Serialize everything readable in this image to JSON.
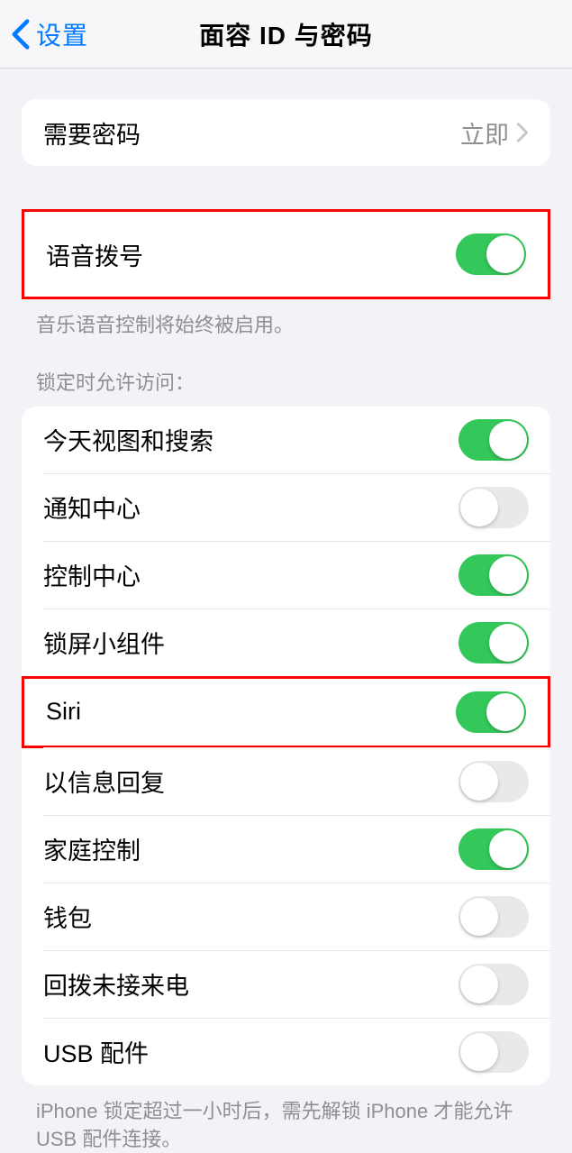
{
  "nav": {
    "back_label": "设置",
    "title": "面容 ID 与密码"
  },
  "require_passcode": {
    "label": "需要密码",
    "value": "立即"
  },
  "voice_dial": {
    "label": "语音拨号",
    "footer": "音乐语音控制将始终被启用。"
  },
  "lock_section": {
    "header": "锁定时允许访问：",
    "items": [
      {
        "label": "今天视图和搜索",
        "on": true
      },
      {
        "label": "通知中心",
        "on": false
      },
      {
        "label": "控制中心",
        "on": true
      },
      {
        "label": "锁屏小组件",
        "on": true
      },
      {
        "label": "Siri",
        "on": true
      },
      {
        "label": "以信息回复",
        "on": false
      },
      {
        "label": "家庭控制",
        "on": true
      },
      {
        "label": "钱包",
        "on": false
      },
      {
        "label": "回拨未接来电",
        "on": false
      },
      {
        "label": "USB 配件",
        "on": false
      }
    ],
    "footer": "iPhone 锁定超过一小时后，需先解锁 iPhone 才能允许USB 配件连接。"
  }
}
